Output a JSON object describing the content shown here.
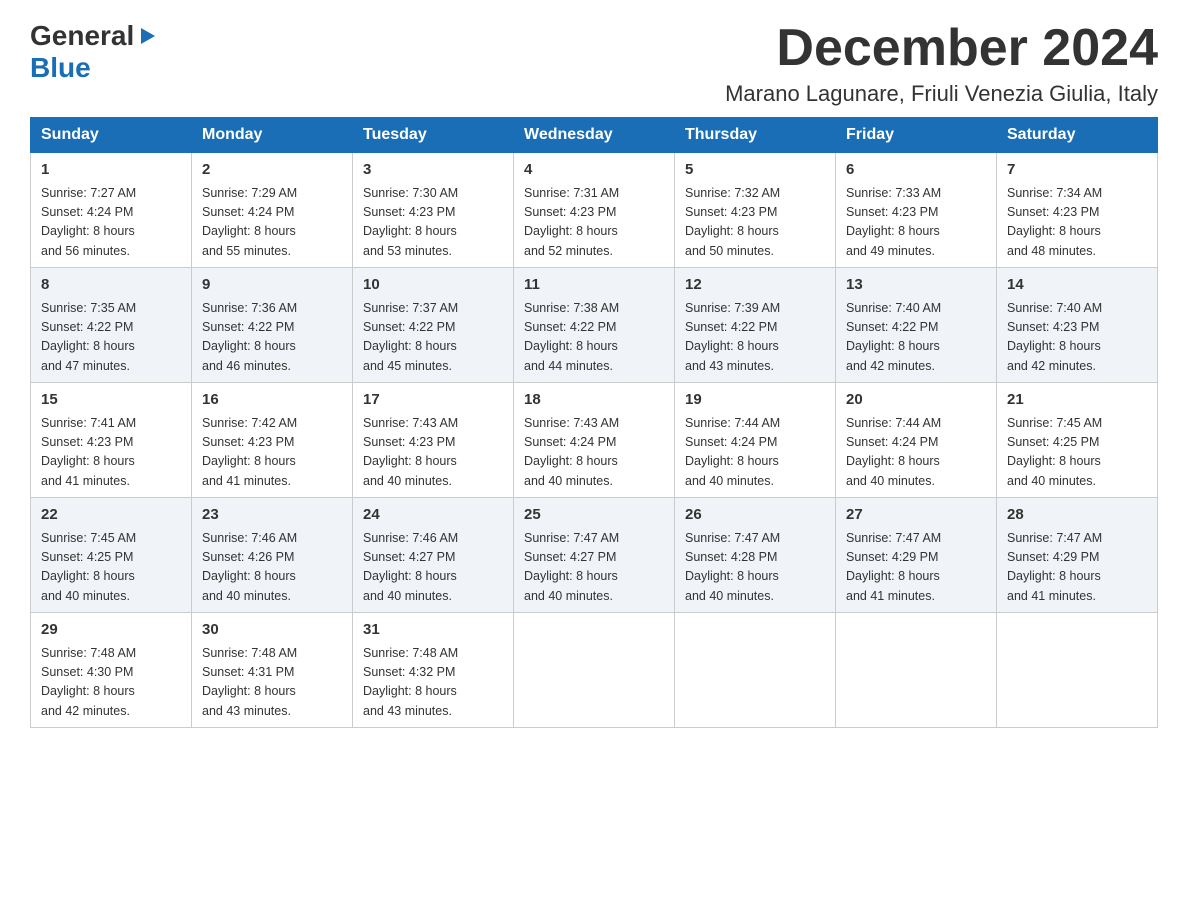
{
  "header": {
    "logo": {
      "general": "General",
      "blue": "Blue",
      "arrow": "▶"
    },
    "title": "December 2024",
    "location": "Marano Lagunare, Friuli Venezia Giulia, Italy"
  },
  "weekdays": [
    "Sunday",
    "Monday",
    "Tuesday",
    "Wednesday",
    "Thursday",
    "Friday",
    "Saturday"
  ],
  "weeks": [
    [
      {
        "day": "1",
        "sunrise": "7:27 AM",
        "sunset": "4:24 PM",
        "daylight": "8 hours and 56 minutes."
      },
      {
        "day": "2",
        "sunrise": "7:29 AM",
        "sunset": "4:24 PM",
        "daylight": "8 hours and 55 minutes."
      },
      {
        "day": "3",
        "sunrise": "7:30 AM",
        "sunset": "4:23 PM",
        "daylight": "8 hours and 53 minutes."
      },
      {
        "day": "4",
        "sunrise": "7:31 AM",
        "sunset": "4:23 PM",
        "daylight": "8 hours and 52 minutes."
      },
      {
        "day": "5",
        "sunrise": "7:32 AM",
        "sunset": "4:23 PM",
        "daylight": "8 hours and 50 minutes."
      },
      {
        "day": "6",
        "sunrise": "7:33 AM",
        "sunset": "4:23 PM",
        "daylight": "8 hours and 49 minutes."
      },
      {
        "day": "7",
        "sunrise": "7:34 AM",
        "sunset": "4:23 PM",
        "daylight": "8 hours and 48 minutes."
      }
    ],
    [
      {
        "day": "8",
        "sunrise": "7:35 AM",
        "sunset": "4:22 PM",
        "daylight": "8 hours and 47 minutes."
      },
      {
        "day": "9",
        "sunrise": "7:36 AM",
        "sunset": "4:22 PM",
        "daylight": "8 hours and 46 minutes."
      },
      {
        "day": "10",
        "sunrise": "7:37 AM",
        "sunset": "4:22 PM",
        "daylight": "8 hours and 45 minutes."
      },
      {
        "day": "11",
        "sunrise": "7:38 AM",
        "sunset": "4:22 PM",
        "daylight": "8 hours and 44 minutes."
      },
      {
        "day": "12",
        "sunrise": "7:39 AM",
        "sunset": "4:22 PM",
        "daylight": "8 hours and 43 minutes."
      },
      {
        "day": "13",
        "sunrise": "7:40 AM",
        "sunset": "4:22 PM",
        "daylight": "8 hours and 42 minutes."
      },
      {
        "day": "14",
        "sunrise": "7:40 AM",
        "sunset": "4:23 PM",
        "daylight": "8 hours and 42 minutes."
      }
    ],
    [
      {
        "day": "15",
        "sunrise": "7:41 AM",
        "sunset": "4:23 PM",
        "daylight": "8 hours and 41 minutes."
      },
      {
        "day": "16",
        "sunrise": "7:42 AM",
        "sunset": "4:23 PM",
        "daylight": "8 hours and 41 minutes."
      },
      {
        "day": "17",
        "sunrise": "7:43 AM",
        "sunset": "4:23 PM",
        "daylight": "8 hours and 40 minutes."
      },
      {
        "day": "18",
        "sunrise": "7:43 AM",
        "sunset": "4:24 PM",
        "daylight": "8 hours and 40 minutes."
      },
      {
        "day": "19",
        "sunrise": "7:44 AM",
        "sunset": "4:24 PM",
        "daylight": "8 hours and 40 minutes."
      },
      {
        "day": "20",
        "sunrise": "7:44 AM",
        "sunset": "4:24 PM",
        "daylight": "8 hours and 40 minutes."
      },
      {
        "day": "21",
        "sunrise": "7:45 AM",
        "sunset": "4:25 PM",
        "daylight": "8 hours and 40 minutes."
      }
    ],
    [
      {
        "day": "22",
        "sunrise": "7:45 AM",
        "sunset": "4:25 PM",
        "daylight": "8 hours and 40 minutes."
      },
      {
        "day": "23",
        "sunrise": "7:46 AM",
        "sunset": "4:26 PM",
        "daylight": "8 hours and 40 minutes."
      },
      {
        "day": "24",
        "sunrise": "7:46 AM",
        "sunset": "4:27 PM",
        "daylight": "8 hours and 40 minutes."
      },
      {
        "day": "25",
        "sunrise": "7:47 AM",
        "sunset": "4:27 PM",
        "daylight": "8 hours and 40 minutes."
      },
      {
        "day": "26",
        "sunrise": "7:47 AM",
        "sunset": "4:28 PM",
        "daylight": "8 hours and 40 minutes."
      },
      {
        "day": "27",
        "sunrise": "7:47 AM",
        "sunset": "4:29 PM",
        "daylight": "8 hours and 41 minutes."
      },
      {
        "day": "28",
        "sunrise": "7:47 AM",
        "sunset": "4:29 PM",
        "daylight": "8 hours and 41 minutes."
      }
    ],
    [
      {
        "day": "29",
        "sunrise": "7:48 AM",
        "sunset": "4:30 PM",
        "daylight": "8 hours and 42 minutes."
      },
      {
        "day": "30",
        "sunrise": "7:48 AM",
        "sunset": "4:31 PM",
        "daylight": "8 hours and 43 minutes."
      },
      {
        "day": "31",
        "sunrise": "7:48 AM",
        "sunset": "4:32 PM",
        "daylight": "8 hours and 43 minutes."
      },
      {
        "day": "",
        "sunrise": "",
        "sunset": "",
        "daylight": ""
      },
      {
        "day": "",
        "sunrise": "",
        "sunset": "",
        "daylight": ""
      },
      {
        "day": "",
        "sunrise": "",
        "sunset": "",
        "daylight": ""
      },
      {
        "day": "",
        "sunrise": "",
        "sunset": "",
        "daylight": ""
      }
    ]
  ],
  "labels": {
    "sunrise": "Sunrise: ",
    "sunset": "Sunset: ",
    "daylight": "Daylight: "
  }
}
